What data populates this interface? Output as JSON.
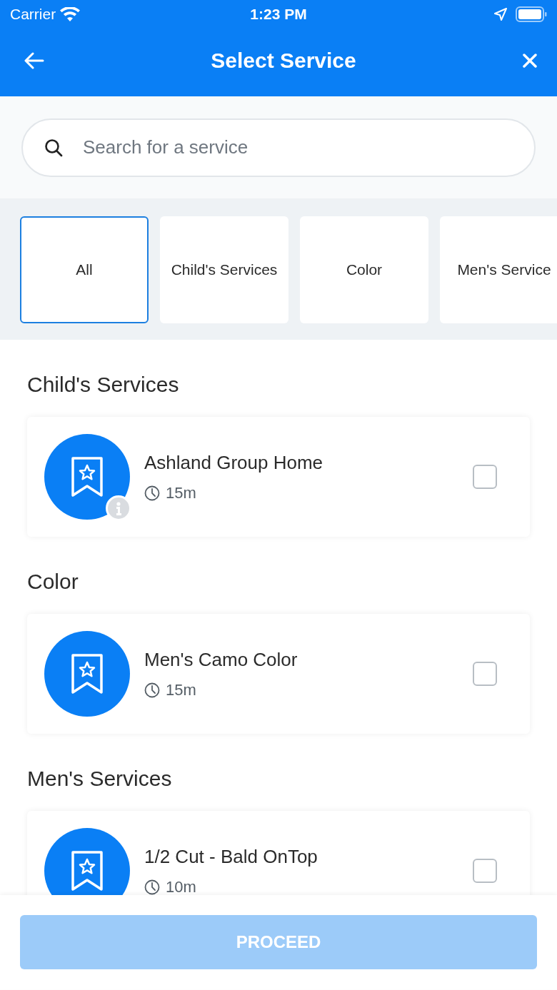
{
  "status_bar": {
    "carrier": "Carrier",
    "time": "1:23 PM"
  },
  "header": {
    "title": "Select Service"
  },
  "search": {
    "placeholder": "Search for a service"
  },
  "categories": [
    {
      "label": "All",
      "selected": true
    },
    {
      "label": "Child's Services",
      "selected": false
    },
    {
      "label": "Color",
      "selected": false
    },
    {
      "label": "Men's Service",
      "selected": false
    }
  ],
  "sections": [
    {
      "title": "Child's Services",
      "services": [
        {
          "name": "Ashland Group Home",
          "duration": "15m",
          "has_info": true,
          "checked": false
        }
      ]
    },
    {
      "title": "Color",
      "services": [
        {
          "name": "Men's Camo Color",
          "duration": "15m",
          "has_info": false,
          "checked": false
        }
      ]
    },
    {
      "title": "Men's Services",
      "services": [
        {
          "name": "1/2 Cut - Bald OnTop",
          "duration": "10m",
          "has_info": false,
          "checked": false
        }
      ]
    }
  ],
  "footer": {
    "button": {
      "label": "PROCEED",
      "disabled": true
    }
  }
}
